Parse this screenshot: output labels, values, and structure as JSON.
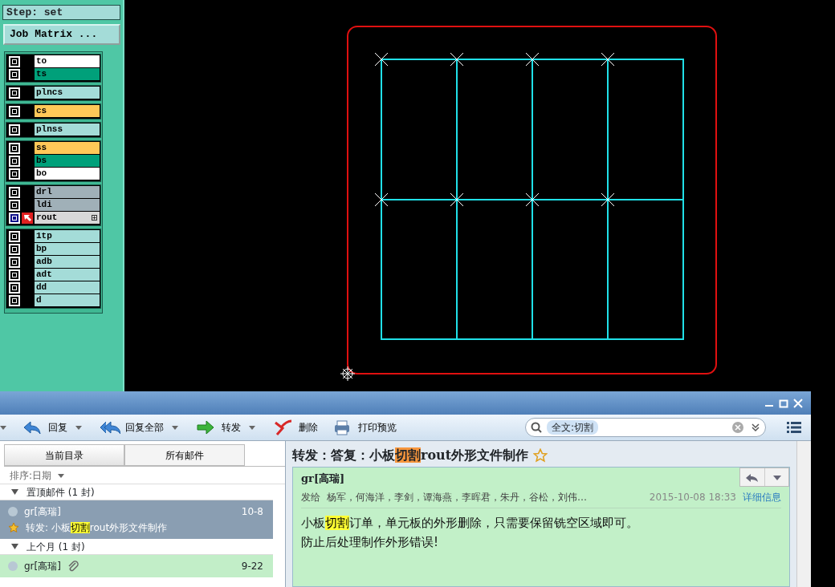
{
  "layer_panel": {
    "step": "Step: set",
    "matrix_button": "Job Matrix ...",
    "groups": [
      [
        {
          "name": "to",
          "color": "#ffffff",
          "selected": false,
          "checked": true
        },
        {
          "name": "ts",
          "color": "#00a07a",
          "selected": false,
          "checked": true
        }
      ],
      [
        {
          "name": "plncs",
          "color": "#a4dcd8",
          "selected": false,
          "checked": true
        }
      ],
      [
        {
          "name": "cs",
          "color": "#ffc858",
          "selected": false,
          "checked": true
        }
      ],
      [
        {
          "name": "plnss",
          "color": "#a4dcd8",
          "selected": false,
          "checked": true
        }
      ],
      [
        {
          "name": "ss",
          "color": "#ffc858",
          "selected": false,
          "checked": true
        },
        {
          "name": "bs",
          "color": "#00a07a",
          "selected": false,
          "checked": true
        },
        {
          "name": "bo",
          "color": "#ffffff",
          "selected": false,
          "checked": true
        }
      ],
      [
        {
          "name": "drl",
          "color": "#a0b0b8",
          "selected": false,
          "checked": true
        },
        {
          "name": "ldi",
          "color": "#a0b0b8",
          "selected": false,
          "checked": true
        },
        {
          "name": "rout",
          "color": "#d8d8d8",
          "selected": true,
          "checked": true
        }
      ],
      [
        {
          "name": "1tp",
          "color": "#a4dcd8",
          "selected": false,
          "checked": true
        },
        {
          "name": "bp",
          "color": "#a4dcd8",
          "selected": false,
          "checked": true
        },
        {
          "name": "adb",
          "color": "#a4dcd8",
          "selected": false,
          "checked": true
        },
        {
          "name": "adt",
          "color": "#a4dcd8",
          "selected": false,
          "checked": true
        },
        {
          "name": "dd",
          "color": "#a4dcd8",
          "selected": false,
          "checked": true
        },
        {
          "name": "d",
          "color": "#a4dcd8",
          "selected": false,
          "checked": true
        }
      ]
    ]
  },
  "mail_window": {
    "toolbar": [
      {
        "kind": "reply",
        "label": "回复",
        "dropdown": true
      },
      {
        "kind": "reply-all",
        "label": "回复全部",
        "dropdown": true
      },
      {
        "kind": "forward",
        "label": "转发",
        "dropdown": true
      },
      {
        "kind": "delete",
        "label": "删除",
        "dropdown": false
      },
      {
        "kind": "print",
        "label": "打印预览",
        "dropdown": false
      }
    ],
    "search": {
      "token": "全文:切割"
    },
    "folder_tabs": [
      {
        "label": "当前目录",
        "selected": true
      },
      {
        "label": "所有邮件",
        "selected": false
      }
    ],
    "sort": "排序:日期",
    "groups": [
      {
        "title": "置顶邮件 (1 封)",
        "expanded": true,
        "mails": [
          {
            "sender": "gr[高瑞]",
            "date": "10-8",
            "selected": true,
            "starred": true,
            "attachment": false,
            "subject_parts": [
              {
                "text": "转发: 小板",
                "highlight": false
              },
              {
                "text": "切割",
                "highlight": true
              },
              {
                "text": "rout外形文件制作",
                "highlight": false
              }
            ]
          }
        ]
      },
      {
        "title": "上个月 (1 封)",
        "expanded": true,
        "mails": [
          {
            "sender": "gr[高瑞]",
            "date": "9-22",
            "selected": false,
            "attachment": true
          }
        ]
      }
    ],
    "reading": {
      "subject_parts": [
        {
          "text": "转发：答复：小板",
          "highlight": false
        },
        {
          "text": "切割",
          "highlight": true
        },
        {
          "text": "rout外形文件制作",
          "highlight": false
        }
      ],
      "starred": false,
      "sender": "gr[高瑞]",
      "recipients_label": "发给",
      "recipients": "杨军，何海洋，李剑，谭海燕，李晖君，朱丹，谷松，刘伟…",
      "time": "2015-10-08 18:33",
      "details_link": "详细信息",
      "body": [
        [
          {
            "text": "小板",
            "highlight": false
          },
          {
            "text": "切割",
            "highlight": true
          },
          {
            "text": "订单，单元板的外形删除，只需要保留铣空区域即可。",
            "highlight": false
          }
        ],
        [
          {
            "text": "防止后处理制作外形错误!",
            "highlight": false
          }
        ]
      ]
    }
  }
}
